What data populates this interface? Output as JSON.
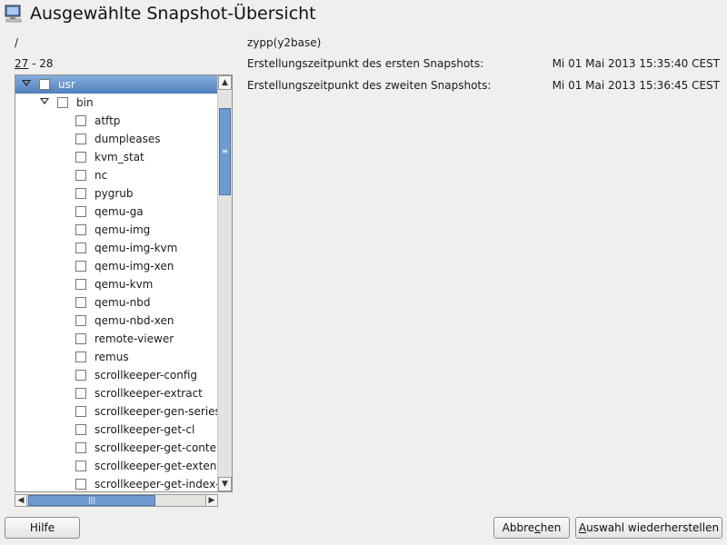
{
  "window": {
    "title": "Ausgewählte Snapshot-Übersicht",
    "icon": "computer-icon"
  },
  "path": "/",
  "range": {
    "first": "27",
    "separator": " - ",
    "second": "28"
  },
  "info": {
    "description": "zypp(y2base)",
    "first_label": "Erstellungszeitpunkt des ersten Snapshots:",
    "first_value": "Mi 01 Mai 2013 15:35:40 CEST",
    "second_label": "Erstellungszeitpunkt des zweiten Snapshots:",
    "second_value": "Mi 01 Mai 2013 15:36:45 CEST"
  },
  "tree": {
    "root": {
      "label": "usr",
      "selected": true,
      "expanded": true,
      "checked": false
    },
    "folder": {
      "label": "bin",
      "expanded": true,
      "checked": false
    },
    "files": [
      "atftp",
      "dumpleases",
      "kvm_stat",
      "nc",
      "pygrub",
      "qemu-ga",
      "qemu-img",
      "qemu-img-kvm",
      "qemu-img-xen",
      "qemu-kvm",
      "qemu-nbd",
      "qemu-nbd-xen",
      "remote-viewer",
      "remus",
      "scrollkeeper-config",
      "scrollkeeper-extract",
      "scrollkeeper-gen-seriesid",
      "scrollkeeper-get-cl",
      "scrollkeeper-get-content-list",
      "scrollkeeper-get-extended-content-list",
      "scrollkeeper-get-index-from-docpath"
    ]
  },
  "scrollbars": {
    "vertical_position": 0.1,
    "horizontal_position": 0.0
  },
  "buttons": {
    "help": "Hilfe",
    "cancel_pre": "Abbre",
    "cancel_acc": "c",
    "cancel_post": "hen",
    "restore_acc": "A",
    "restore_post": "uswahl wiederherstellen"
  },
  "colors": {
    "selection": "#5f8fc9",
    "background": "#efefed"
  }
}
